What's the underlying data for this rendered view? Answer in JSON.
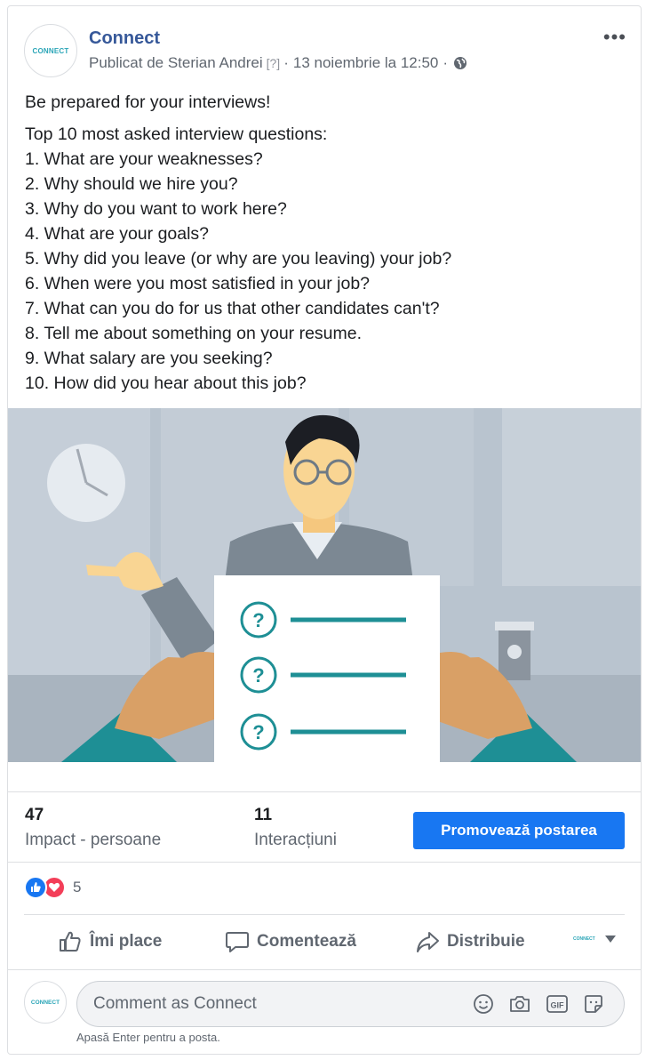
{
  "post": {
    "page_name": "Connect",
    "logo_text": "CONNECT",
    "published_by": "Publicat de Sterian Andrei",
    "help_marker": "[?]",
    "separator": "·",
    "timestamp": "13 noiembrie la 12:50",
    "more_icon": "more-dots-icon",
    "headline": "Be prepared for your interviews!",
    "list_title": "Top 10 most asked interview questions:",
    "questions": [
      "1. What are your weaknesses?",
      "2. Why should we hire you?",
      "3. Why do you want to work here?",
      "4. What are your goals?",
      "5. Why did you leave (or why are you leaving) your job?",
      "6. When were you most satisfied in your job?",
      "7. What can you do for us that other candidates can't?",
      "8. Tell me about something on your resume.",
      "9. What salary are you seeking?",
      "10. How did you hear about this job?"
    ],
    "illustration_mark": "?"
  },
  "stats": {
    "reach_value": "47",
    "reach_label": "Impact - persoane",
    "engagement_value": "11",
    "engagement_label": "Interacțiuni",
    "promote_label": "Promovează postarea"
  },
  "reactions": {
    "types": [
      "like-icon",
      "love-icon"
    ],
    "count": "5"
  },
  "actions": {
    "like": "Îmi place",
    "comment": "Comentează",
    "share": "Distribuie"
  },
  "comment": {
    "placeholder": "Comment as Connect",
    "hint": "Apasă Enter pentru a posta.",
    "gif_label": "GIF"
  },
  "colors": {
    "brand": "#365899",
    "primary": "#1877f2",
    "teal": "#1e8f95",
    "love": "#f33e58"
  }
}
